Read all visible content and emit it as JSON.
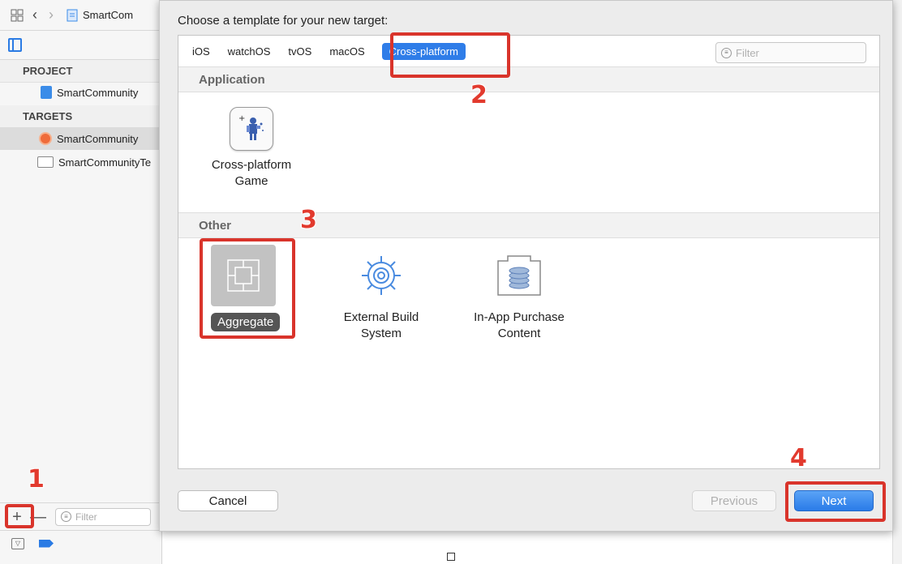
{
  "navigator": {
    "file_name": "SmartCom",
    "project_header": "PROJECT",
    "project_item": "SmartCommunity",
    "targets_header": "TARGETS",
    "targets": [
      {
        "label": "SmartCommunity",
        "icon": "app-icon",
        "selected": true
      },
      {
        "label": "SmartCommunityTe",
        "icon": "bundle-icon",
        "selected": false
      }
    ],
    "add_symbol": "+",
    "remove_symbol": "—",
    "filter_placeholder": "Filter"
  },
  "dialog": {
    "title": "Choose a template for your new target:",
    "tabs": [
      {
        "label": "iOS",
        "active": false
      },
      {
        "label": "watchOS",
        "active": false
      },
      {
        "label": "tvOS",
        "active": false
      },
      {
        "label": "macOS",
        "active": false
      },
      {
        "label": "Cross-platform",
        "active": true
      }
    ],
    "filter_placeholder": "Filter",
    "groups": {
      "application": "Application",
      "other": "Other"
    },
    "templates": {
      "game": "Cross-platform\nGame",
      "aggregate": "Aggregate",
      "external_build": "External Build\nSystem",
      "in_app": "In-App Purchase\nContent"
    },
    "buttons": {
      "cancel": "Cancel",
      "previous": "Previous",
      "next": "Next"
    }
  },
  "annotations": {
    "step1": "1",
    "step2": "2",
    "step3": "3",
    "step4": "4",
    "color": "#d9342b"
  }
}
